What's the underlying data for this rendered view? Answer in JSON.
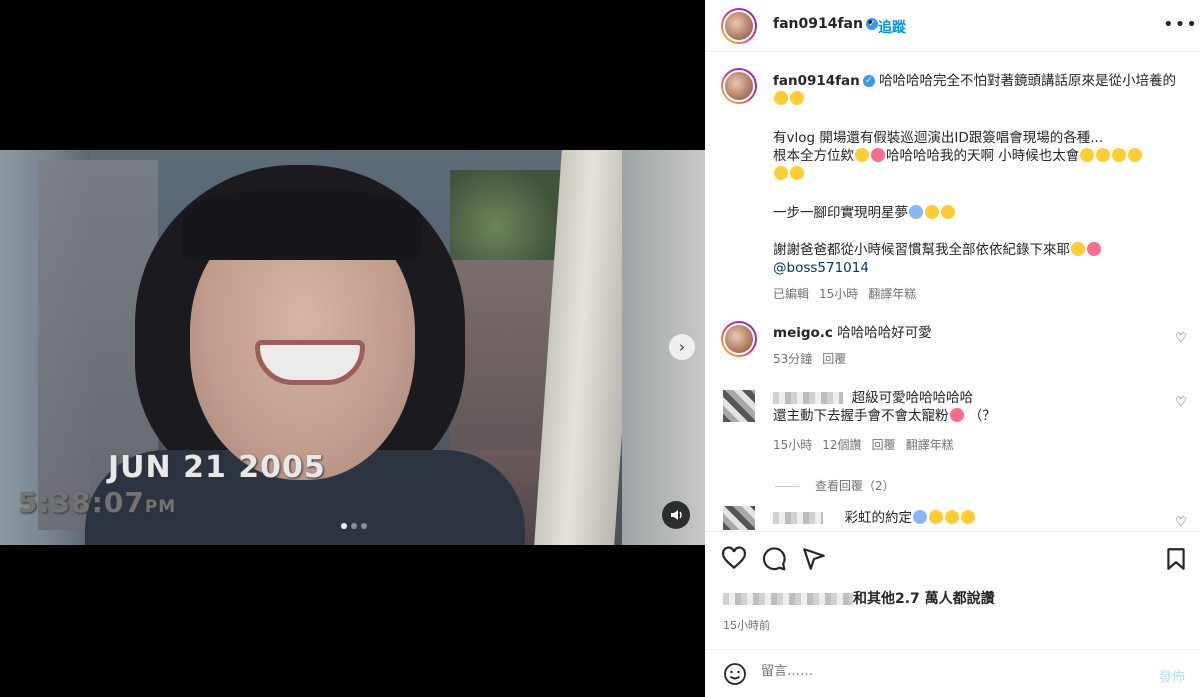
{
  "post": {
    "author": "fan0914fan",
    "follow_label": "追蹤",
    "dot": "•",
    "more_icon": "more-horizontal-icon"
  },
  "media": {
    "stamp_date": "JUN 21 2005",
    "stamp_time": "5:38:07",
    "stamp_ampm": "PM",
    "carousel_count": 3,
    "carousel_active": 1
  },
  "caption": {
    "author": "fan0914fan",
    "line1": "哈哈哈哈完全不怕對著鏡頭講話原來是從小培養的",
    "para2_line1": "有vlog 開場還有假裝巡迴演出ID跟簽唱會現場的各種...",
    "para2_line2": "根本全方位欸",
    "para2_line2b": "哈哈哈哈我的天啊 小時候也太會",
    "para3": "一步一腳印實現明星夢",
    "para4": "謝謝爸爸都從小時候習慣幫我全部依依紀錄下來耶",
    "mention": "@boss571014",
    "edited": "已編輯",
    "time": "15小時",
    "translate": "翻譯年糕"
  },
  "comments": [
    {
      "user": "meigo.c",
      "text": "哈哈哈哈好可愛",
      "time": "53分鐘",
      "reply": "回覆"
    },
    {
      "user": "",
      "text_line1": "超級可愛哈哈哈哈哈",
      "text_line2": "還主動下去握手會不會太寵粉",
      "text_tail": "（？",
      "time": "15小時",
      "likes": "12個讚",
      "reply": "回覆",
      "translate": "翻譯年糕",
      "view_replies": "查看回覆（2）"
    },
    {
      "user": "",
      "text": "彩虹的約定"
    }
  ],
  "footer": {
    "likes_text": "和其他2.7 萬人都說讚",
    "time": "15小時前",
    "comment_placeholder": "留言……",
    "post_label": "發佈"
  }
}
